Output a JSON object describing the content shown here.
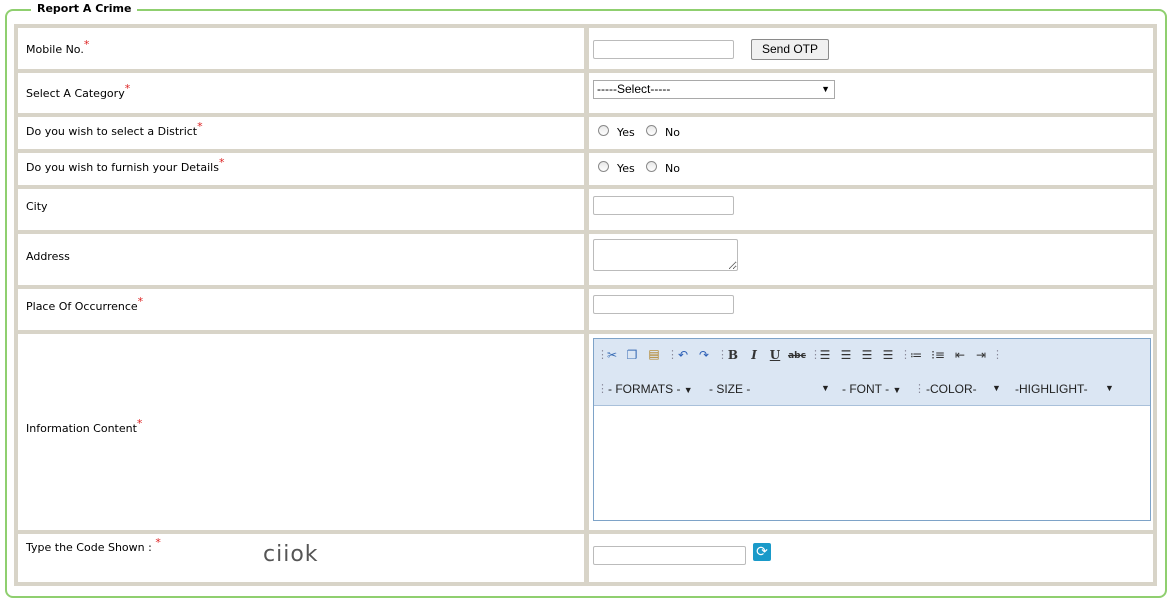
{
  "form": {
    "legend": "Report A Crime",
    "required_mark": "*",
    "mobile": {
      "label": "Mobile No.",
      "value": "",
      "send_otp_label": "Send OTP"
    },
    "category": {
      "label": "Select A Category",
      "selected": "-----Select-----"
    },
    "district": {
      "label": "Do you wish to select a District",
      "yes": "Yes",
      "no": "No"
    },
    "details": {
      "label": "Do you wish to furnish your Details",
      "yes": "Yes",
      "no": "No"
    },
    "city": {
      "label": "City",
      "value": ""
    },
    "address": {
      "label": "Address",
      "value": ""
    },
    "place": {
      "label": "Place Of Occurrence",
      "value": ""
    },
    "information": {
      "label": "Information Content",
      "toolbar_icons": [
        "cut-icon",
        "copy-icon",
        "paste-icon",
        "undo-icon",
        "redo-icon",
        "bold-icon",
        "italic-icon",
        "underline-icon",
        "strikethrough-icon",
        "justify-icon",
        "align-left-icon",
        "align-center-icon",
        "align-right-icon",
        "ordered-list-icon",
        "unordered-list-icon",
        "outdent-icon",
        "indent-icon"
      ],
      "formats": "- FORMATS -",
      "size": "- SIZE -",
      "font": "- FONT -",
      "color": "-COLOR-",
      "highlight": "-HIGHLIGHT-"
    },
    "captcha": {
      "label": "Type the Code Shown :",
      "code": "ciiok",
      "value": ""
    }
  },
  "colors": {
    "border_green": "#8fcf6f",
    "grid": "#d8d4c8",
    "required": "#dd2222",
    "editor_bar": "#dbe6f3"
  }
}
